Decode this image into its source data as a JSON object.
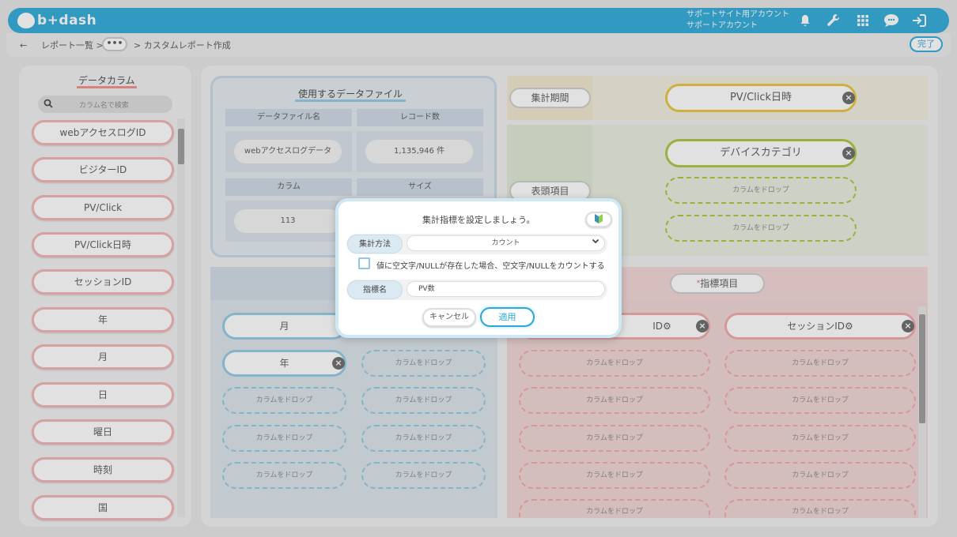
{
  "header": {
    "logo": "b+dash",
    "support_line1": "サポートサイト用アカウント",
    "support_line2": "サポートアカウント",
    "icons": [
      "bell-icon",
      "wrench-icon",
      "grid-icon",
      "chat-icon",
      "logout-icon"
    ]
  },
  "breadcrumb": {
    "back": "←",
    "report_list": "レポート一覧 >",
    "ellipsis": "•••",
    "current": "> カスタムレポート作成",
    "done": "完了"
  },
  "left_panel": {
    "title": "データカラム",
    "search_placeholder": "カラム名で検索",
    "columns": [
      "webアクセスログID",
      "ビジターID",
      "PV/Click",
      "PV/Click日時",
      "セッションID",
      "年",
      "月",
      "日",
      "曜日",
      "時刻",
      "国"
    ]
  },
  "data_file": {
    "title": "使用するデータファイル",
    "file_name_label": "データファイル名",
    "record_count_label": "レコード数",
    "file_name": "webアクセスログデータ",
    "record_count": "1,135,946 件",
    "column_label": "カラム",
    "size_label": "サイズ",
    "column_count": "113"
  },
  "period": {
    "label": "集計期間",
    "value": "PV/Click日時"
  },
  "header_items": {
    "label": "表頭項目",
    "items": [
      "デバイスカテゴリ"
    ],
    "drop_placeholder": "カラムをドロップ"
  },
  "metric": {
    "label": "指標項目",
    "required_mark": "*",
    "item_partial": "ID⚙",
    "item_session": "セッションID⚙"
  },
  "row_items": {
    "items": [
      "月",
      "年"
    ]
  },
  "drop_placeholder": "カラムをドロップ",
  "modal": {
    "title": "集計指標を設定しましょう。",
    "help_icon": "beginner-icon",
    "method_label": "集計方法",
    "method_value": "カウント",
    "checkbox_label": "値に空文字/NULLが存在した場合、空文字/NULLをカウントする",
    "checkbox_checked": false,
    "name_label": "指標名",
    "name_value": "PV数",
    "cancel": "キャンセル",
    "apply": "適用"
  },
  "colors": {
    "brand": "#2aa8d8",
    "metric_accent": "#f0a6a6",
    "header_accent": "#a9c43a",
    "period_accent": "#e8c23b"
  }
}
